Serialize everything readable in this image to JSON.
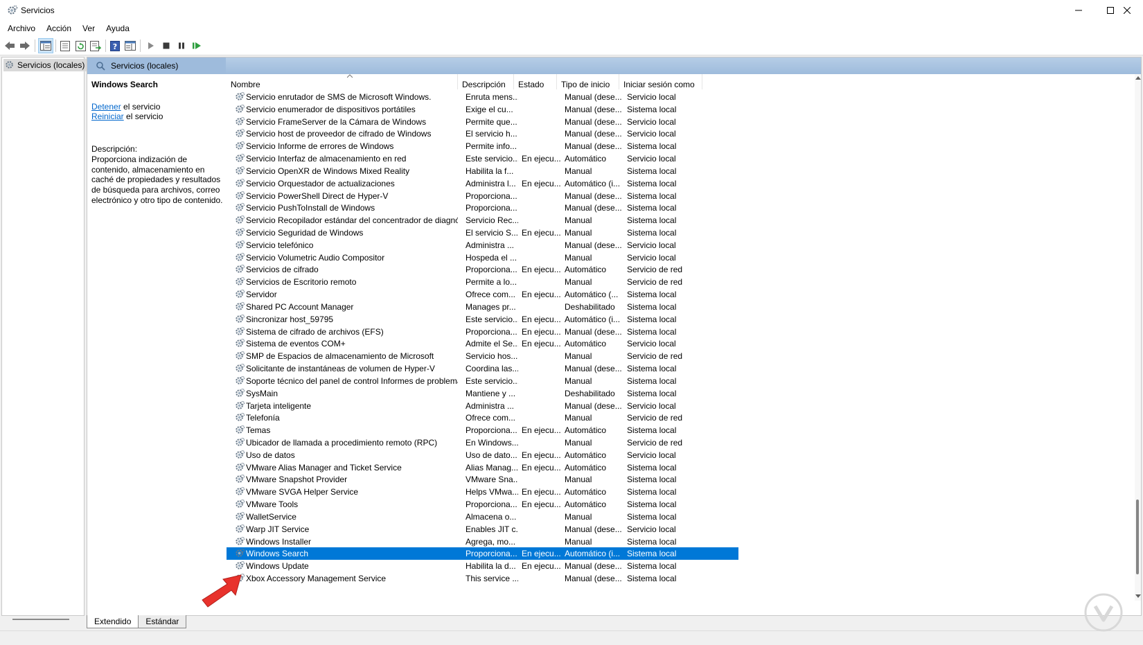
{
  "window": {
    "title": "Servicios"
  },
  "menu": [
    "Archivo",
    "Acción",
    "Ver",
    "Ayuda"
  ],
  "tree": {
    "root_label": "Servicios (locales)"
  },
  "panel": {
    "header_title": "Servicios (locales)"
  },
  "detail": {
    "service_name": "Windows Search",
    "stop_link": "Detener",
    "stop_suffix": " el servicio",
    "restart_link": "Reiniciar",
    "restart_suffix": " el servicio",
    "description_label": "Descripción:",
    "description": "Proporciona indización de contenido, almacenamiento en caché de propiedades y resultados de búsqueda para archivos, correo electrónico y otro tipo de contenido."
  },
  "columns": {
    "name": "Nombre",
    "description": "Descripción",
    "state": "Estado",
    "startup": "Tipo de inicio",
    "logon": "Iniciar sesión como"
  },
  "services": [
    [
      "Servicio enrutador de SMS de Microsoft Windows.",
      "Enruta mens...",
      "",
      "Manual (dese...",
      "Servicio local"
    ],
    [
      "Servicio enumerador de dispositivos portátiles",
      "Exige el cu...",
      "",
      "Manual (dese...",
      "Sistema local"
    ],
    [
      "Servicio FrameServer de la Cámara de Windows",
      "Permite que...",
      "",
      "Manual (dese...",
      "Servicio local"
    ],
    [
      "Servicio host de proveedor de cifrado de Windows",
      "El servicio h...",
      "",
      "Manual (dese...",
      "Servicio local"
    ],
    [
      "Servicio Informe de errores de Windows",
      "Permite info...",
      "",
      "Manual (dese...",
      "Sistema local"
    ],
    [
      "Servicio Interfaz de almacenamiento en red",
      "Este servicio...",
      "En ejecu...",
      "Automático",
      "Servicio local"
    ],
    [
      "Servicio OpenXR de Windows Mixed Reality",
      "Habilita la f...",
      "",
      "Manual",
      "Sistema local"
    ],
    [
      "Servicio Orquestador de actualizaciones",
      "Administra l...",
      "En ejecu...",
      "Automático (i...",
      "Sistema local"
    ],
    [
      "Servicio PowerShell Direct de Hyper-V",
      "Proporciona...",
      "",
      "Manual (dese...",
      "Sistema local"
    ],
    [
      "Servicio PushToInstall de Windows",
      "Proporciona...",
      "",
      "Manual (dese...",
      "Sistema local"
    ],
    [
      "Servicio Recopilador estándar del concentrador de diagnósti...",
      "Servicio Rec...",
      "",
      "Manual",
      "Sistema local"
    ],
    [
      "Servicio Seguridad de Windows",
      "El servicio S...",
      "En ejecu...",
      "Manual",
      "Sistema local"
    ],
    [
      "Servicio telefónico",
      "Administra ...",
      "",
      "Manual (dese...",
      "Servicio local"
    ],
    [
      "Servicio Volumetric Audio Compositor",
      "Hospeda el ...",
      "",
      "Manual",
      "Servicio local"
    ],
    [
      "Servicios de cifrado",
      "Proporciona...",
      "En ejecu...",
      "Automático",
      "Servicio de red"
    ],
    [
      "Servicios de Escritorio remoto",
      "Permite a lo...",
      "",
      "Manual",
      "Servicio de red"
    ],
    [
      "Servidor",
      "Ofrece com...",
      "En ejecu...",
      "Automático (...",
      "Sistema local"
    ],
    [
      "Shared PC Account Manager",
      "Manages pr...",
      "",
      "Deshabilitado",
      "Sistema local"
    ],
    [
      "Sincronizar host_59795",
      "Este servicio...",
      "En ejecu...",
      "Automático (i...",
      "Sistema local"
    ],
    [
      "Sistema de cifrado de archivos (EFS)",
      "Proporciona...",
      "En ejecu...",
      "Manual (dese...",
      "Sistema local"
    ],
    [
      "Sistema de eventos COM+",
      "Admite el Se...",
      "En ejecu...",
      "Automático",
      "Servicio local"
    ],
    [
      "SMP de Espacios de almacenamiento de Microsoft",
      "Servicio hos...",
      "",
      "Manual",
      "Servicio de red"
    ],
    [
      "Solicitante de instantáneas de volumen de Hyper-V",
      "Coordina las...",
      "",
      "Manual (dese...",
      "Sistema local"
    ],
    [
      "Soporte técnico del panel de control Informes de problemas",
      "Este servicio...",
      "",
      "Manual",
      "Sistema local"
    ],
    [
      "SysMain",
      "Mantiene y ...",
      "",
      "Deshabilitado",
      "Sistema local"
    ],
    [
      "Tarjeta inteligente",
      "Administra ...",
      "",
      "Manual (dese...",
      "Servicio local"
    ],
    [
      "Telefonía",
      "Ofrece com...",
      "",
      "Manual",
      "Servicio de red"
    ],
    [
      "Temas",
      "Proporciona...",
      "En ejecu...",
      "Automático",
      "Sistema local"
    ],
    [
      "Ubicador de llamada a procedimiento remoto (RPC)",
      "En Windows...",
      "",
      "Manual",
      "Servicio de red"
    ],
    [
      "Uso de datos",
      "Uso de dato...",
      "En ejecu...",
      "Automático",
      "Servicio local"
    ],
    [
      "VMware Alias Manager and Ticket Service",
      "Alias Manag...",
      "En ejecu...",
      "Automático",
      "Sistema local"
    ],
    [
      "VMware Snapshot Provider",
      "VMware Sna...",
      "",
      "Manual",
      "Sistema local"
    ],
    [
      "VMware SVGA Helper Service",
      "Helps VMwa...",
      "En ejecu...",
      "Automático",
      "Sistema local"
    ],
    [
      "VMware Tools",
      "Proporciona...",
      "En ejecu...",
      "Automático",
      "Sistema local"
    ],
    [
      "WalletService",
      "Almacena o...",
      "",
      "Manual",
      "Sistema local"
    ],
    [
      "Warp JIT Service",
      "Enables JIT c...",
      "",
      "Manual (dese...",
      "Servicio local"
    ],
    [
      "Windows Installer",
      "Agrega, mo...",
      "",
      "Manual",
      "Sistema local"
    ],
    [
      "Windows Search",
      "Proporciona...",
      "En ejecu...",
      "Automático (i...",
      "Sistema local"
    ],
    [
      "Windows Update",
      "Habilita la d...",
      "En ejecu...",
      "Manual (dese...",
      "Sistema local"
    ],
    [
      "Xbox Accessory Management Service",
      "This service ...",
      "",
      "Manual (dese...",
      "Sistema local"
    ]
  ],
  "selected_service": "Windows Search",
  "bottom_tabs": [
    "Extendido",
    "Estándar"
  ],
  "colors": {
    "selection": "#0078d7",
    "header_band": "#9ebbdc",
    "link": "#0066cc",
    "callout_arrow": "#e8322c"
  }
}
